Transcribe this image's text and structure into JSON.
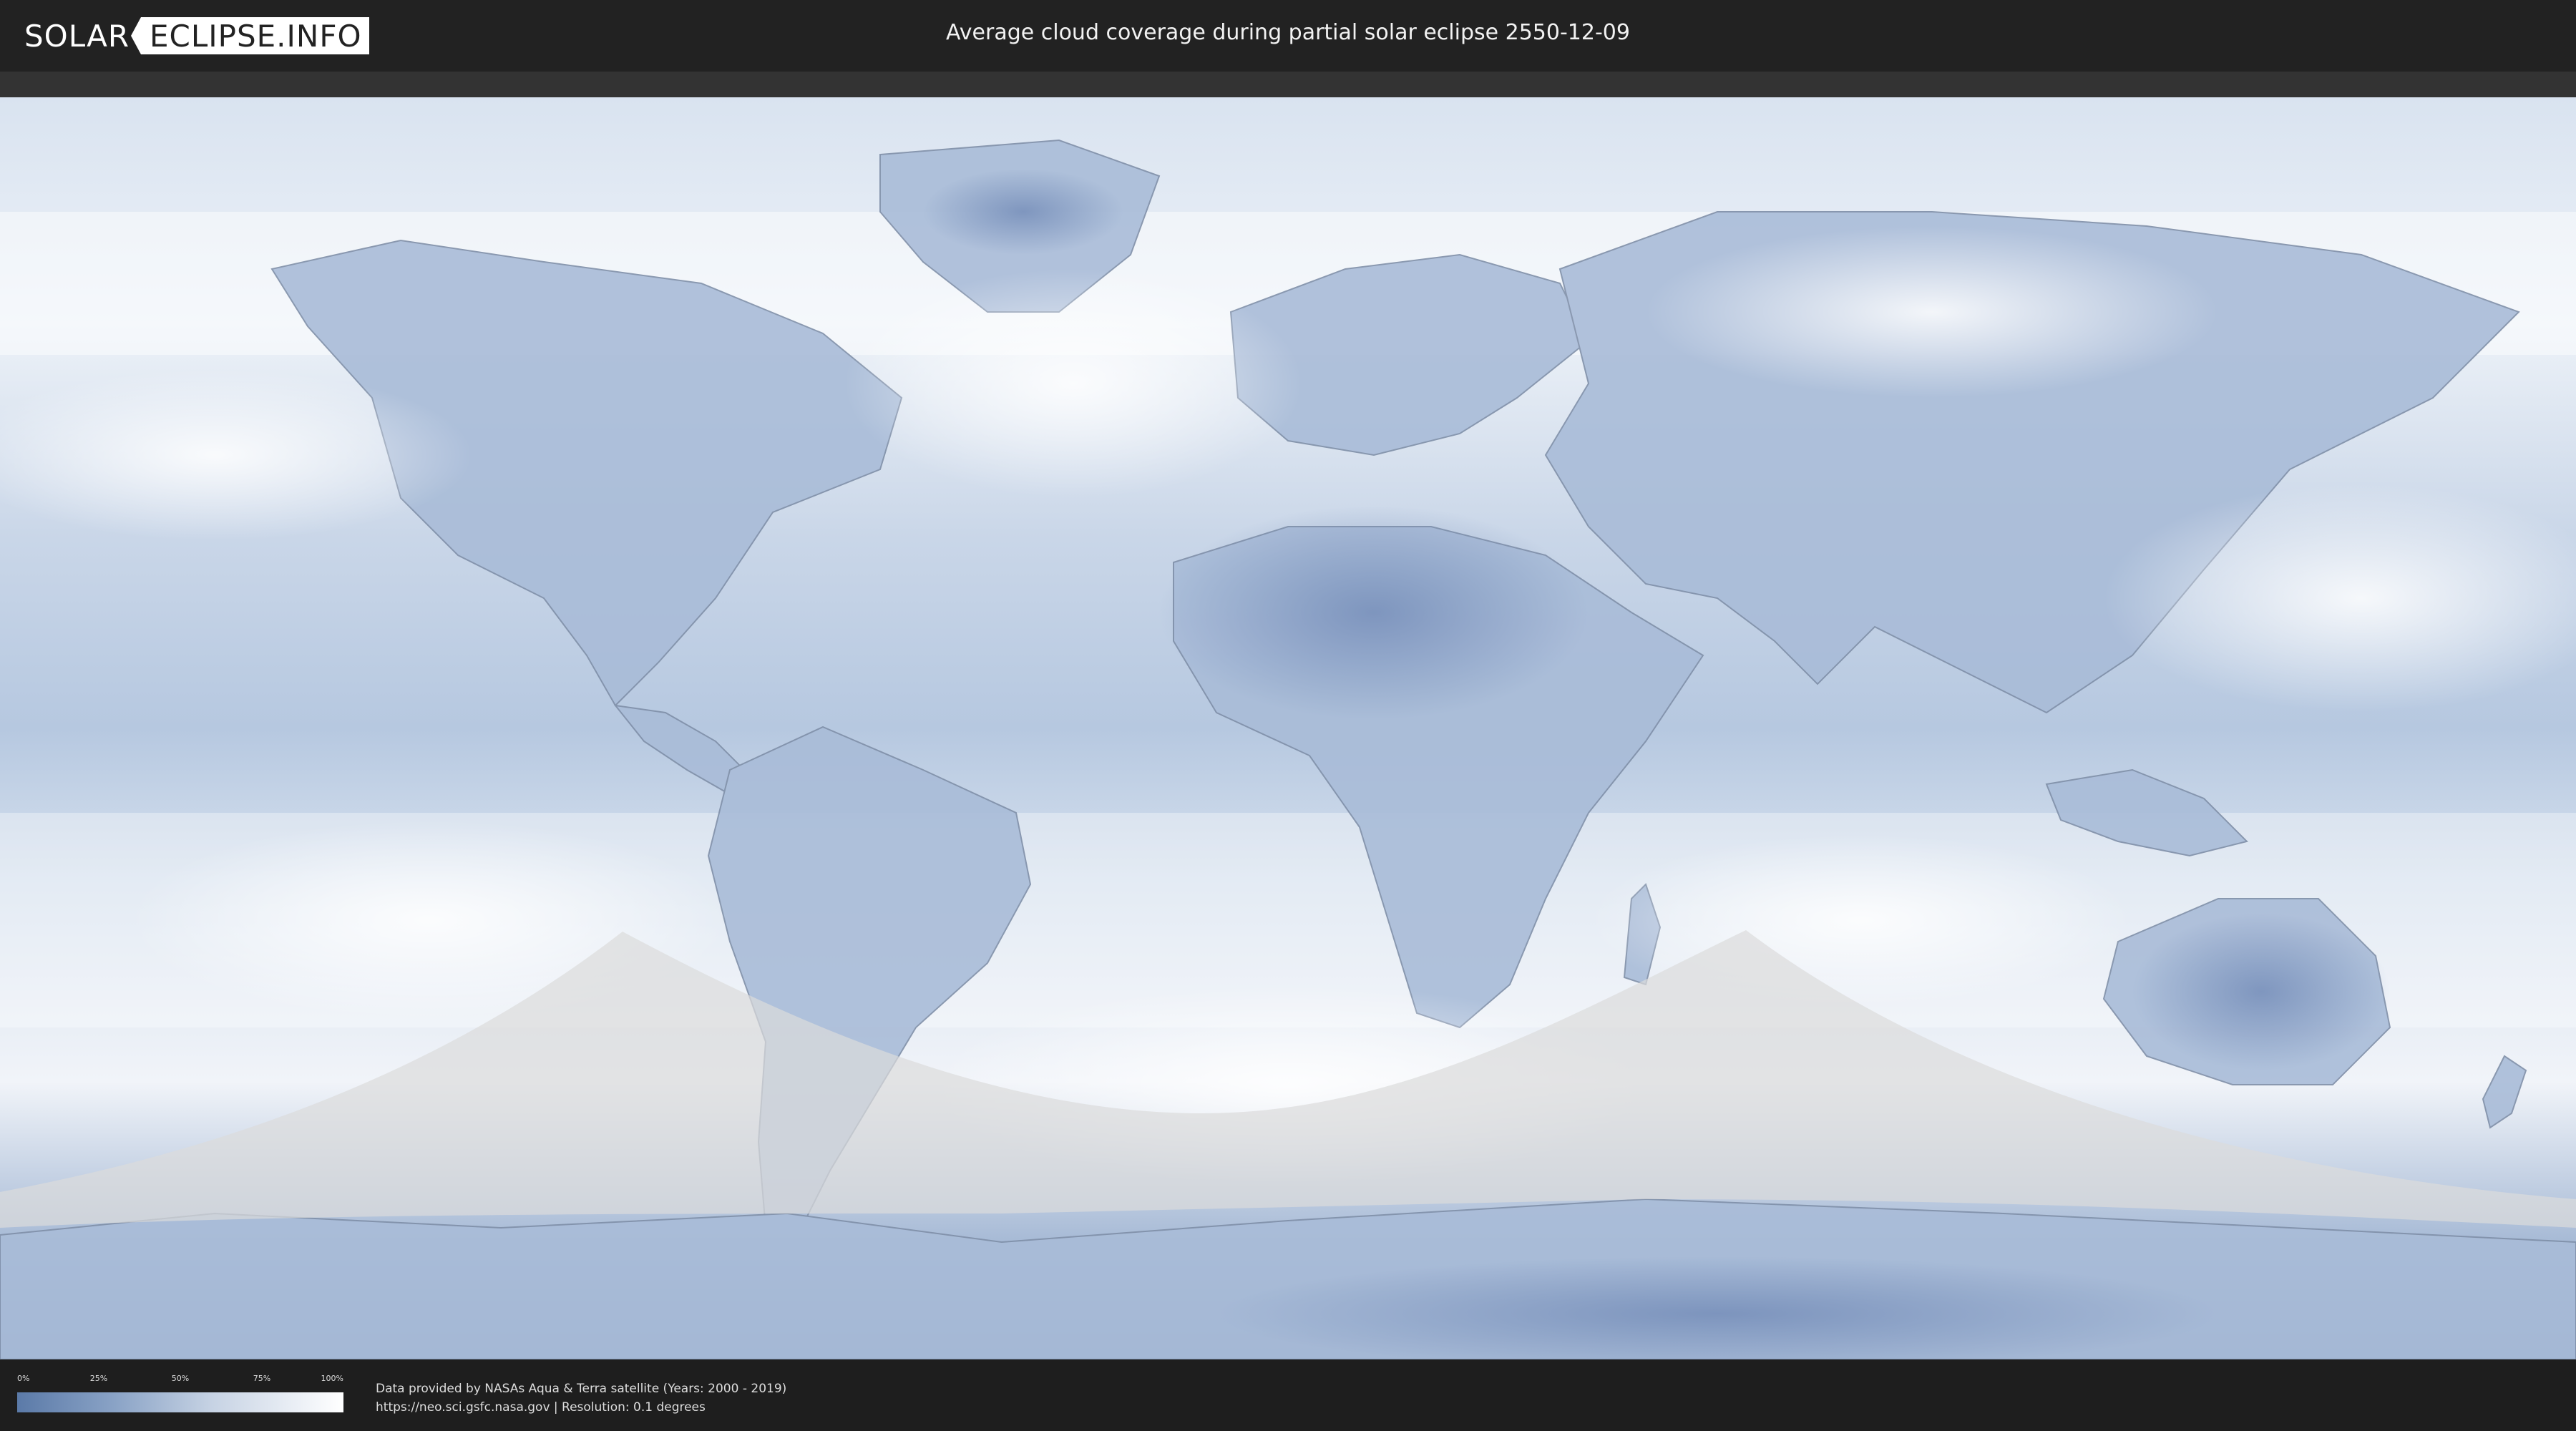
{
  "header": {
    "logo_left": "SOLAR",
    "logo_right": "ECLIPSE.INFO",
    "title": "Average cloud coverage during partial solar eclipse 2550-12-09"
  },
  "legend": {
    "ticks": [
      "0%",
      "25%",
      "50%",
      "75%",
      "100%"
    ],
    "tick_values": [
      0,
      25,
      50,
      75,
      100
    ],
    "colors": {
      "low": "#5b7aa8",
      "mid": "#c7d3e4",
      "high": "#ffffff"
    }
  },
  "footer": {
    "credit_line_1": "Data provided by NASAs Aqua & Terra satellite (Years: 2000 - 2019)",
    "credit_line_2": "https://neo.sci.gsfc.nasa.gov | Resolution: 0.1 degrees"
  },
  "map": {
    "projection": "equirectangular",
    "ocean_color": "#e7edf5",
    "land_color": "#9fb3d1",
    "dense_cloud_color": "#6f88b5",
    "eclipse_shadow_color": "#d8d8d8",
    "icons": [
      "world-map",
      "eclipse-shadow-overlay"
    ]
  }
}
